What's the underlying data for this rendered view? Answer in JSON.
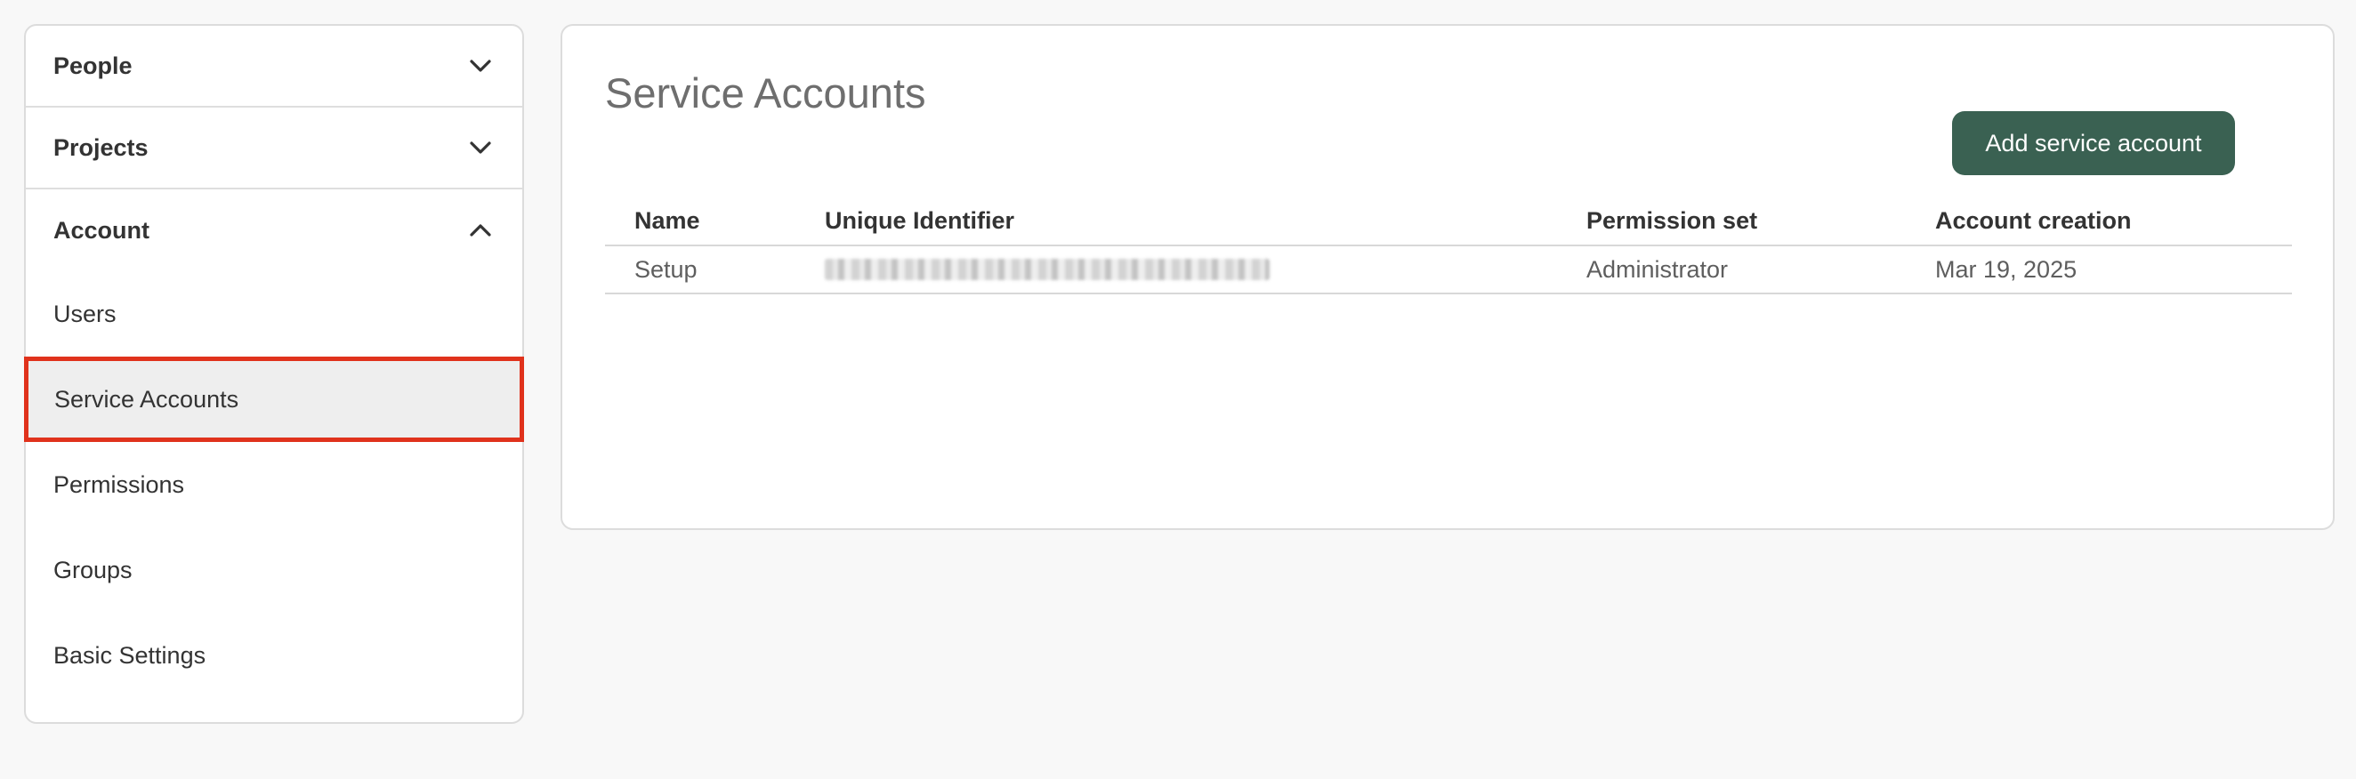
{
  "sidebar": {
    "sections": [
      {
        "label": "People",
        "expanded": false,
        "icon": "chevron-down-icon"
      },
      {
        "label": "Projects",
        "expanded": false,
        "icon": "chevron-down-icon"
      },
      {
        "label": "Account",
        "expanded": true,
        "icon": "chevron-up-icon"
      }
    ],
    "account_items": [
      {
        "label": "Users"
      },
      {
        "label": "Service Accounts",
        "active": true
      },
      {
        "label": "Permissions"
      },
      {
        "label": "Groups"
      },
      {
        "label": "Basic Settings"
      }
    ]
  },
  "main": {
    "title": "Service Accounts",
    "add_button_label": "Add service account",
    "table": {
      "columns": [
        "Name",
        "Unique Identifier",
        "Permission set",
        "Account creation"
      ],
      "rows": [
        {
          "name": "Setup",
          "unique_identifier_redacted": true,
          "permission_set": "Administrator",
          "account_creation": "Mar 19, 2025"
        }
      ]
    }
  },
  "colors": {
    "accent_button": "#3a6152",
    "highlight_border": "#e0321c",
    "active_item_bg": "#eeeeee",
    "page_bg": "#f8f8f8"
  }
}
